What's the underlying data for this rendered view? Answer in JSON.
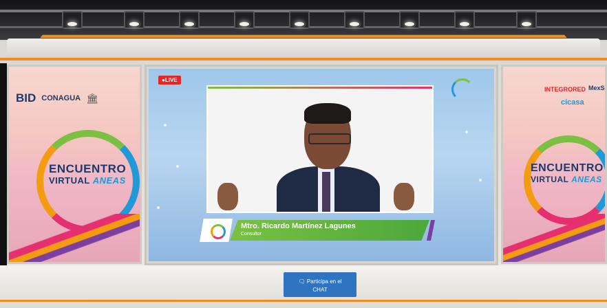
{
  "stage": {
    "live_badge": "●LIVE",
    "speaker": {
      "name": "Mtro. Ricardo Martínez Lagunes",
      "role": "Consultor"
    },
    "chat_button": {
      "label_line1": "Participa en el",
      "label_line2": "CHAT",
      "icon": "chat-icon"
    }
  },
  "left_panel": {
    "logos": [
      "BID",
      "CONAGUA",
      "UNESCO"
    ],
    "event_title_line1": "ENCUENTRO",
    "event_title_line2": "VIRTUAL",
    "event_title_brand": "ANEAS"
  },
  "right_panel": {
    "sponsors": [
      "INTEGRORED",
      "MexSo",
      "cicasa"
    ],
    "event_title_line1": "ENCUENTRO",
    "event_title_line2": "VIRTUAL",
    "event_title_brand": "ANEAS"
  },
  "colors": {
    "accent_orange": "#f08a24",
    "live_red": "#e32626",
    "lower_third_green": "#7bc043",
    "chat_blue": "#2f74c0"
  }
}
